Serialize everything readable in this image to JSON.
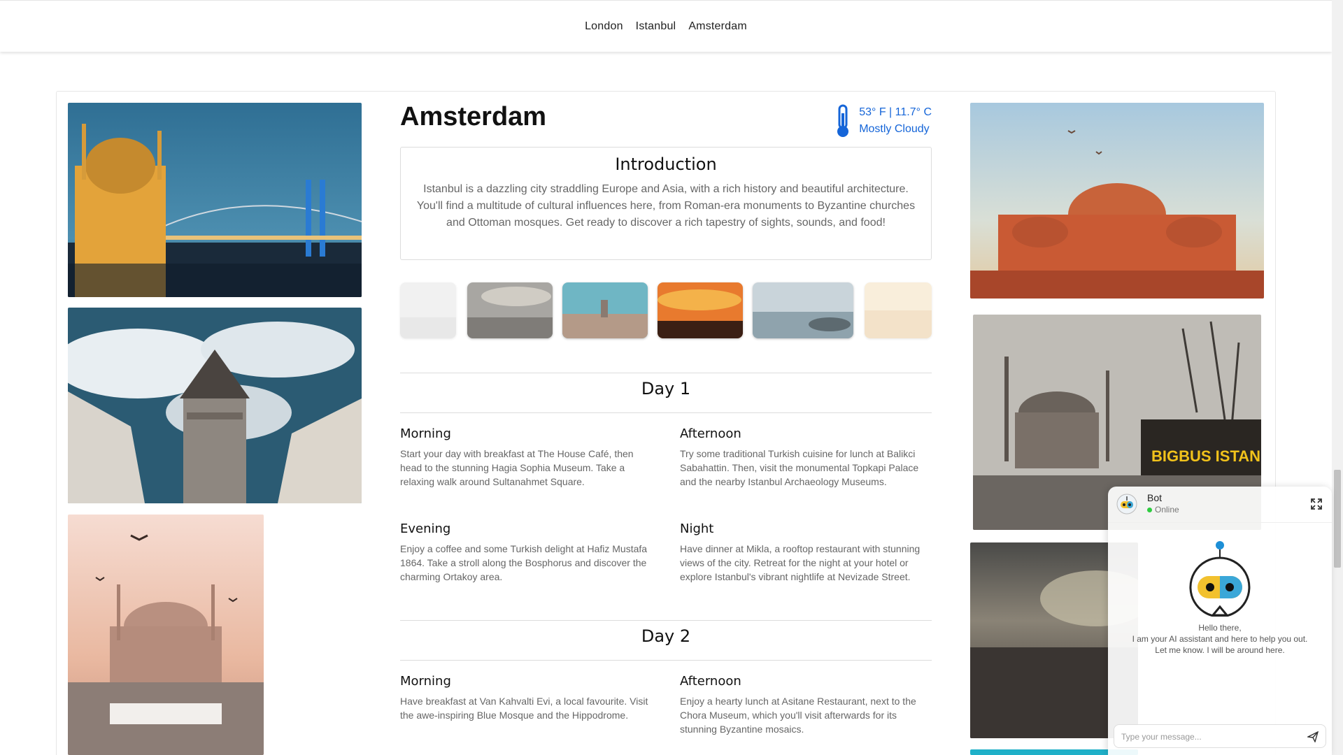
{
  "nav": {
    "items": [
      "London",
      "Istanbul",
      "Amsterdam"
    ]
  },
  "city": {
    "title": "Amsterdam",
    "weather_temp": "53° F | 11.7° C",
    "weather_desc": "Mostly Cloudy"
  },
  "intro": {
    "heading": "Introduction",
    "text": "Istanbul is a dazzling city straddling Europe and Asia, with a rich history and beautiful architecture. You'll find a multitude of cultural influences here, from Roman-era monuments to Byzantine churches and Ottoman mosques. Get ready to discover a rich tapestry of sights, sounds, and food!"
  },
  "days": [
    {
      "title": "Day 1",
      "slots": [
        {
          "label": "Morning",
          "text": "Start your day with breakfast at The House Café, then head to the stunning Hagia Sophia Museum. Take a relaxing walk around Sultanahmet Square."
        },
        {
          "label": "Afternoon",
          "text": "Try some traditional Turkish cuisine for lunch at Balikci Sabahattin. Then, visit the monumental Topkapi Palace and the nearby Istanbul Archaeology Museums."
        },
        {
          "label": "Evening",
          "text": "Enjoy a coffee and some Turkish delight at Hafiz Mustafa 1864. Take a stroll along the Bosphorus and discover the charming Ortakoy area."
        },
        {
          "label": "Night",
          "text": "Have dinner at Mikla, a rooftop restaurant with stunning views of the city. Retreat for the night at your hotel or explore Istanbul's vibrant nightlife at Nevizade Street."
        }
      ]
    },
    {
      "title": "Day 2",
      "slots": [
        {
          "label": "Morning",
          "text": "Have breakfast at Van Kahvalti Evi, a local favourite. Visit the awe-inspiring Blue Mosque and the Hippodrome."
        },
        {
          "label": "Afternoon",
          "text": "Enjoy a hearty lunch at Asitane Restaurant, next to the Chora Museum, which you'll visit afterwards for its stunning Byzantine mosaics."
        }
      ]
    }
  ],
  "chat": {
    "name": "Bot",
    "status": "Online",
    "greeting_1": "Hello there,",
    "greeting_2": "I am your AI assistant and here to help you out.",
    "greeting_3": "Let me know. I will be around here.",
    "placeholder": "Type your message..."
  },
  "photo_sign": "BIGBUS ISTANBUL",
  "colors": {
    "accent": "#1565d8",
    "online": "#2ecc40"
  },
  "icons": [
    "thermometer-icon",
    "expand-icon",
    "send-icon",
    "bot-avatar-icon"
  ]
}
